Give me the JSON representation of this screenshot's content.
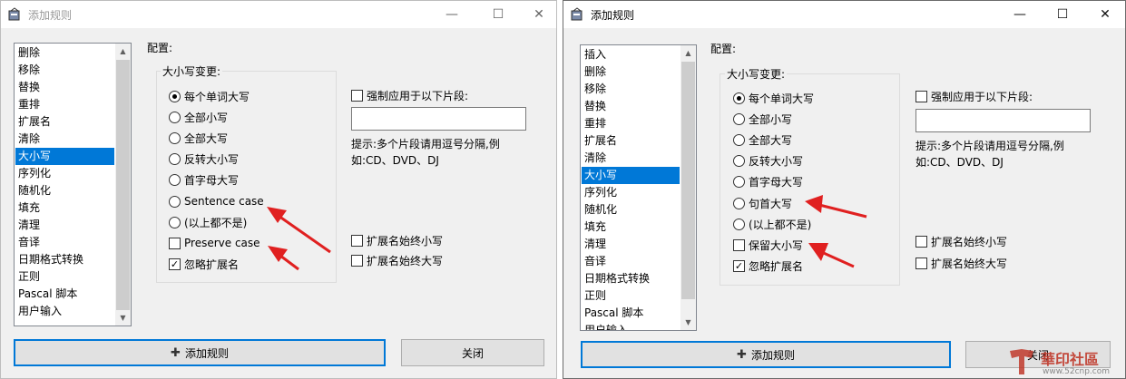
{
  "left": {
    "title": "添加规则",
    "list_items": [
      "删除",
      "移除",
      "替换",
      "重排",
      "扩展名",
      "清除",
      "大小写",
      "序列化",
      "随机化",
      "填充",
      "清理",
      "音译",
      "日期格式转换",
      "正则",
      "Pascal 脚本",
      "用户输入"
    ],
    "selected_item": "大小写",
    "config_label": "配置:",
    "group_title": "大小写变更:",
    "options": [
      "每个单词大写",
      "全部小写",
      "全部大写",
      "反转大小写",
      "首字母大写",
      "Sentence case",
      "(以上都不是)"
    ],
    "checks": [
      {
        "label": "Preserve case",
        "checked": false
      },
      {
        "label": "忽略扩展名",
        "checked": true
      }
    ],
    "force_label": "强制应用于以下片段:",
    "force_value": "",
    "hint_line1": "提示:多个片段请用逗号分隔,例",
    "hint_line2": "如:CD、DVD、DJ",
    "ext_lower": "扩展名始终小写",
    "ext_upper": "扩展名始终大写",
    "add_button": "添加规则",
    "close_button": "关闭"
  },
  "right": {
    "title": "添加规则",
    "list_items": [
      "插入",
      "删除",
      "移除",
      "替换",
      "重排",
      "扩展名",
      "清除",
      "大小写",
      "序列化",
      "随机化",
      "填充",
      "清理",
      "音译",
      "日期格式转换",
      "正则",
      "Pascal 脚本",
      "用户输入"
    ],
    "selected_item": "大小写",
    "config_label": "配置:",
    "group_title": "大小写变更:",
    "options": [
      "每个单词大写",
      "全部小写",
      "全部大写",
      "反转大小写",
      "首字母大写",
      "句首大写",
      "(以上都不是)"
    ],
    "checks": [
      {
        "label": "保留大小写",
        "checked": false
      },
      {
        "label": "忽略扩展名",
        "checked": true
      }
    ],
    "force_label": "强制应用于以下片段:",
    "force_value": "",
    "hint_line1": "提示:多个片段请用逗号分隔,例",
    "hint_line2": "如:CD、DVD、DJ",
    "ext_lower": "扩展名始终小写",
    "ext_upper": "扩展名始终大写",
    "add_button": "添加规则",
    "close_button": "关闭"
  },
  "watermark": {
    "text": "華印社區",
    "url": "www.52cnp.com"
  },
  "colors": {
    "selection": "#0078d7",
    "arrow": "#e02020",
    "watermark": "#c0392b"
  },
  "icons": {
    "minimize": "minimize-icon",
    "maximize": "maximize-icon",
    "close": "close-icon",
    "plus": "plus-icon"
  }
}
